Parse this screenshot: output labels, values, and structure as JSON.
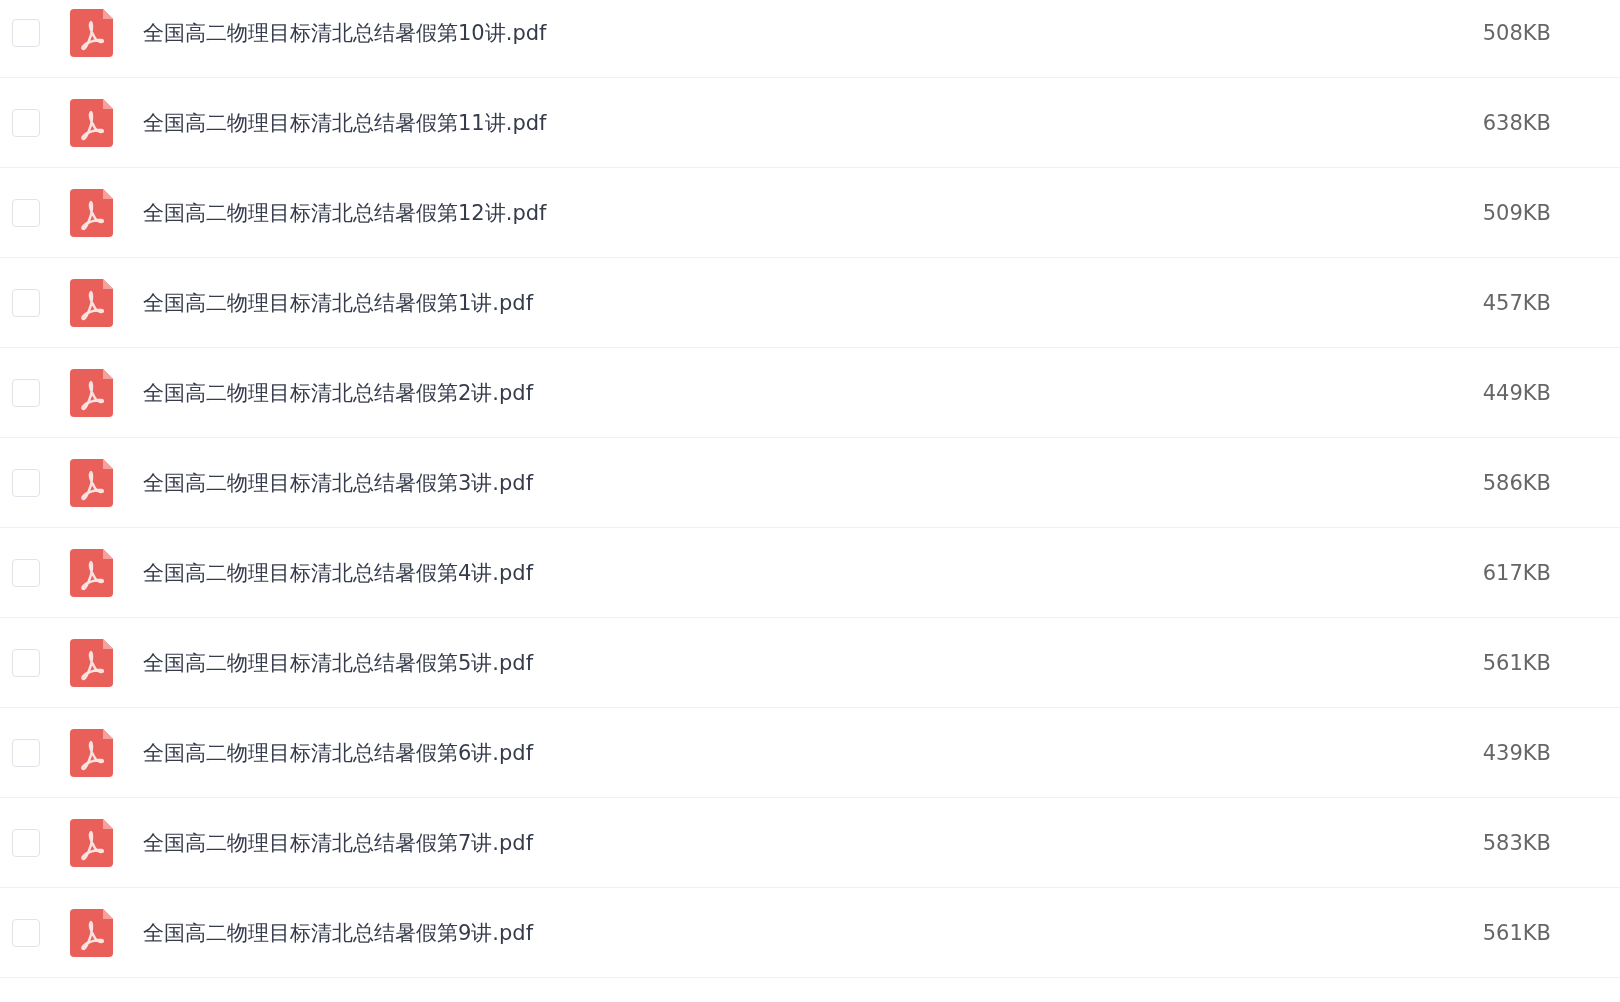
{
  "files": [
    {
      "name": "全国高二物理目标清北总结暑假第10讲.pdf",
      "size": "508KB",
      "checked": false
    },
    {
      "name": "全国高二物理目标清北总结暑假第11讲.pdf",
      "size": "638KB",
      "checked": false
    },
    {
      "name": "全国高二物理目标清北总结暑假第12讲.pdf",
      "size": "509KB",
      "checked": false
    },
    {
      "name": "全国高二物理目标清北总结暑假第1讲.pdf",
      "size": "457KB",
      "checked": false
    },
    {
      "name": "全国高二物理目标清北总结暑假第2讲.pdf",
      "size": "449KB",
      "checked": false
    },
    {
      "name": "全国高二物理目标清北总结暑假第3讲.pdf",
      "size": "586KB",
      "checked": false
    },
    {
      "name": "全国高二物理目标清北总结暑假第4讲.pdf",
      "size": "617KB",
      "checked": false
    },
    {
      "name": "全国高二物理目标清北总结暑假第5讲.pdf",
      "size": "561KB",
      "checked": false
    },
    {
      "name": "全国高二物理目标清北总结暑假第6讲.pdf",
      "size": "439KB",
      "checked": false
    },
    {
      "name": "全国高二物理目标清北总结暑假第7讲.pdf",
      "size": "583KB",
      "checked": false
    },
    {
      "name": "全国高二物理目标清北总结暑假第9讲.pdf",
      "size": "561KB",
      "checked": false
    }
  ]
}
